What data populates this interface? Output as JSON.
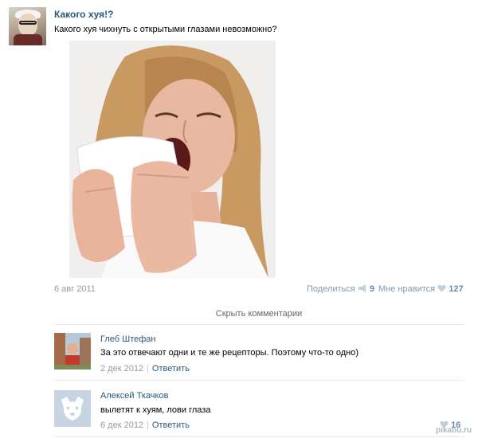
{
  "post": {
    "title": "Какого хуя!?",
    "text": "Какого хуя чихнуть с открытыми глазами невозможно?",
    "date": "6 авг 2011",
    "share_label": "Поделиться",
    "share_count": "9",
    "like_label": "Мне нравится",
    "like_count": "127"
  },
  "comments_toggle": "Скрыть комментарии",
  "comments": [
    {
      "author": "Глеб Штефан",
      "text": "За это отвечают одни и те же рецепторы. Поэтому что-то одно)",
      "date": "2 дек 2012",
      "reply_label": "Ответить"
    },
    {
      "author": "Алексей Ткачков",
      "text": "вылетят к хуям, лови глаза",
      "date": "6 дек 2012",
      "reply_label": "Ответить",
      "likes": "16"
    }
  ],
  "watermark": "pikabu.ru",
  "icons": {
    "share": "megaphone-icon",
    "like": "heart-icon",
    "default_avatar": "dog-face-icon"
  },
  "colors": {
    "link": "#2b587a",
    "meta": "#999999",
    "counter": "#6a8aa8"
  }
}
